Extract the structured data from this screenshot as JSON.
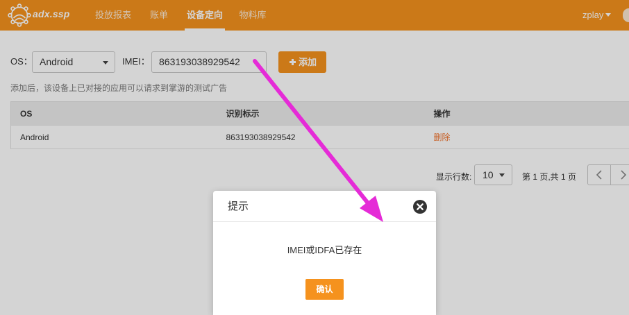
{
  "app": {
    "logo_text": "adx.ssp",
    "nav": [
      {
        "label": "投放报表",
        "active": false
      },
      {
        "label": "账单",
        "active": false
      },
      {
        "label": "设备定向",
        "active": true
      },
      {
        "label": "物料库",
        "active": false
      }
    ],
    "user": {
      "name": "zplay"
    }
  },
  "filter": {
    "os_label": "OS：",
    "os_value": "Android",
    "imei_label": "IMEI：",
    "imei_value": "863193038929542",
    "add_label": "添加",
    "hint": "添加后，该设备上已对接的应用可以请求到掌游的测试广告"
  },
  "table": {
    "headers": [
      "OS",
      "识别标示",
      "操作"
    ],
    "rows": [
      {
        "os": "Android",
        "id": "863193038929542",
        "action": "删除"
      }
    ]
  },
  "pagination": {
    "rows_label": "显示行数:",
    "rows_value": "10",
    "page_info": "第 1 页,共 1 页"
  },
  "modal": {
    "title": "提示",
    "message": "IMEI或IDFA已存在",
    "confirm_label": "确认"
  },
  "icons": {
    "logo": "logo-icon",
    "user_menu": "chevron-down-icon",
    "select": "chevron-down-icon",
    "add": "plus-icon",
    "prev": "chevron-left-icon",
    "next": "chevron-right-icon",
    "close": "close-circle-icon",
    "avatar": "avatar"
  },
  "colors": {
    "brand_orange": "#f5921e",
    "delete_link": "#f0732d",
    "table_header_bg": "#ececec",
    "annotation_arrow": "#e52bd7",
    "overlay": "rgba(0,0,0,0.17)"
  }
}
